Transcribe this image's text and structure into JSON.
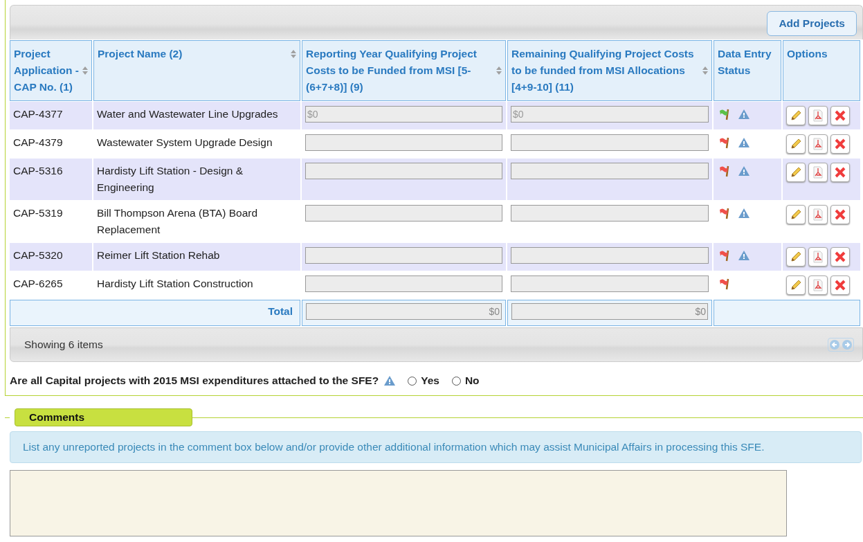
{
  "toolbar": {
    "add_button": "Add Projects"
  },
  "table": {
    "columns": [
      {
        "label": "Project Application - CAP No. (1)",
        "sortable": true
      },
      {
        "label": "Project Name (2)",
        "sortable": true
      },
      {
        "label": "Reporting Year Qualifying Project Costs to be Funded from MSI [5-(6+7+8)] (9)",
        "sortable": true
      },
      {
        "label": "Remaining Qualifying Project Costs to be funded from MSI Allocations [4+9-10] (11)",
        "sortable": true
      },
      {
        "label": "Data Entry Status",
        "sortable": false
      },
      {
        "label": "Options",
        "sortable": false
      }
    ],
    "rows": [
      {
        "cap": "CAP-4377",
        "name": "Water and Wastewater Line Upgrades",
        "reporting_cost": "$0",
        "remaining_cost": "$0",
        "complete": true,
        "warning": true
      },
      {
        "cap": "CAP-4379",
        "name": "Wastewater System Upgrade Design",
        "complete": false,
        "warning": true
      },
      {
        "cap": "CAP-5316",
        "name": "Hardisty Lift Station - Design & Engineering",
        "complete": false,
        "warning": true
      },
      {
        "cap": "CAP-5319",
        "name": "Bill Thompson Arena (BTA) Board Replacement",
        "complete": false,
        "warning": true
      },
      {
        "cap": "CAP-5320",
        "name": "Reimer Lift Station Rehab",
        "complete": false,
        "warning": true
      },
      {
        "cap": "CAP-6265",
        "name": "Hardisty Lift Station Construction",
        "complete": false,
        "warning": false
      }
    ],
    "total": {
      "label": "Total",
      "reporting_cost": "$0",
      "remaining_cost": "$0"
    },
    "footer": "Showing 6 items"
  },
  "question": {
    "text": "Are all Capital projects with 2015 MSI expenditures attached to the SFE?",
    "options": [
      {
        "label": "Yes",
        "selected": false
      },
      {
        "label": "No",
        "selected": false
      }
    ]
  },
  "comments": {
    "title": "Comments",
    "info": "List any unreported projects in the comment box below and/or provide other additional information which may assist Municipal Affairs in processing this SFE."
  }
}
